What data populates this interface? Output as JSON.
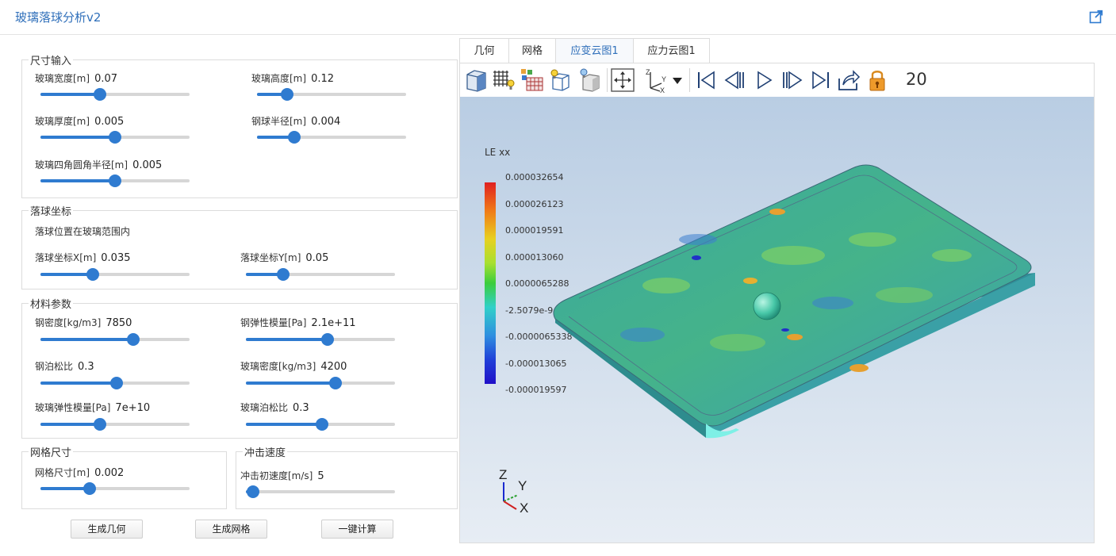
{
  "app": {
    "title": "玻璃落球分析v2"
  },
  "groups": {
    "size": {
      "legend": "尺寸输入",
      "width": {
        "label": "玻璃宽度[m]",
        "value": "0.07",
        "level": 0.4
      },
      "height": {
        "label": "玻璃高度[m]",
        "value": "0.12",
        "level": 0.2
      },
      "thickness": {
        "label": "玻璃厚度[m]",
        "value": "0.005",
        "level": 0.5
      },
      "ball_radius": {
        "label": "钢球半径[m]",
        "value": "0.004",
        "level": 0.25
      },
      "corner_radius": {
        "label": "玻璃四角圆角半径[m]",
        "value": "0.005",
        "level": 0.5
      }
    },
    "drop": {
      "legend": "落球坐标",
      "note": "落球位置在玻璃范围内",
      "x": {
        "label": "落球坐标X[m]",
        "value": "0.035",
        "level": 0.35
      },
      "y": {
        "label": "落球坐标Y[m]",
        "value": "0.05",
        "level": 0.25
      }
    },
    "material": {
      "legend": "材料参数",
      "steel_density": {
        "label": "钢密度[kg/m3]",
        "value": "7850",
        "level": 0.62
      },
      "steel_modulus": {
        "label": "钢弹性模量[Pa]",
        "value": "2.1e+11",
        "level": 0.55
      },
      "steel_poisson": {
        "label": "钢泊松比",
        "value": "0.3",
        "level": 0.51
      },
      "glass_density": {
        "label": "玻璃密度[kg/m3]",
        "value": "4200",
        "level": 0.6
      },
      "glass_modulus": {
        "label": "玻璃弹性模量[Pa]",
        "value": "7e+10",
        "level": 0.4
      },
      "glass_poisson": {
        "label": "玻璃泊松比",
        "value": "0.3",
        "level": 0.51
      }
    },
    "mesh": {
      "legend": "网格尺寸",
      "size": {
        "label": "网格尺寸[m]",
        "value": "0.002",
        "level": 0.33
      }
    },
    "impact": {
      "legend": "冲击速度",
      "speed": {
        "label": "冲击初速度[m/s]",
        "value": "5",
        "level": 0.05
      }
    }
  },
  "buttons": {
    "gen_geometry": "生成几何",
    "gen_mesh": "生成网格",
    "compute": "一键计算"
  },
  "tabs": [
    "几何",
    "网格",
    "应变云图1",
    "应力云图1"
  ],
  "active_tab": 2,
  "toolbar": {
    "icons": [
      "solid-view-icon",
      "mesh-light-icon",
      "color-mesh-icon",
      "wireframe-light-icon",
      "shaded-light-icon",
      "fit-view-icon",
      "axis-orientation-icon",
      "dropdown-icon",
      "first-frame-icon",
      "previous-frame-icon",
      "play-icon",
      "next-frame-icon",
      "last-frame-icon",
      "export-icon",
      "lock-icon"
    ],
    "frame": "20"
  },
  "legend": {
    "title": "LE xx",
    "labels": [
      "0.000032654",
      "0.000026123",
      "0.000019591",
      "0.000013060",
      "0.0000065288",
      "-2.5079e-9",
      "-0.0000065338",
      "-0.000013065",
      "-0.000019597"
    ]
  },
  "axes": {
    "z": "Z",
    "y": "Y",
    "x": "X"
  },
  "colors": {
    "accent": "#2f7bd0",
    "title": "#2f6fba",
    "track": "#d6d6d6"
  }
}
